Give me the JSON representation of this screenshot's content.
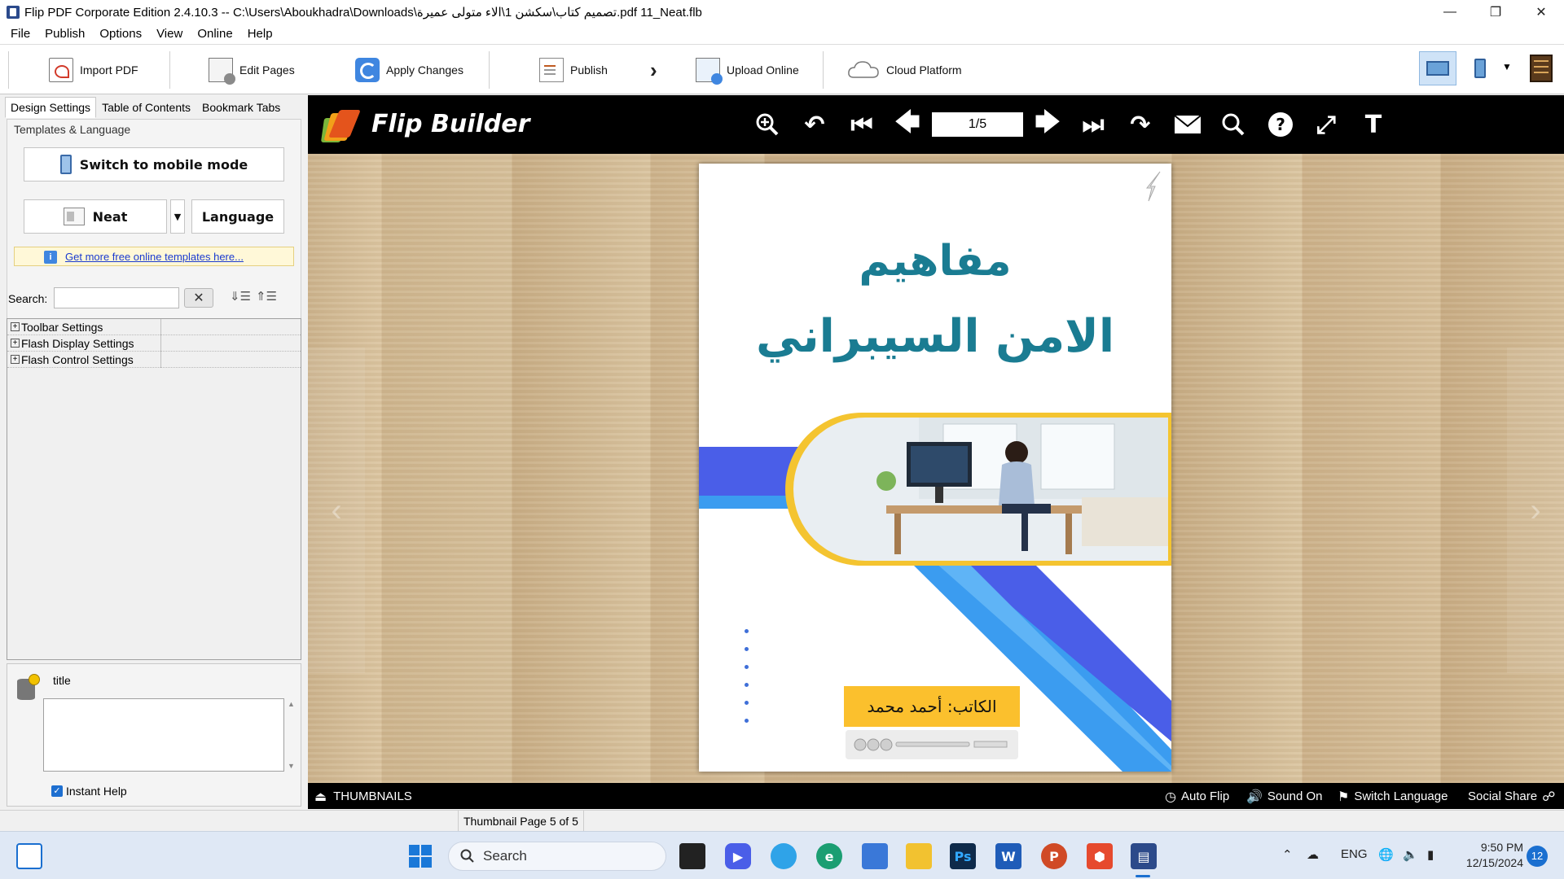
{
  "window": {
    "title": "Flip PDF Corporate Edition 2.4.10.3 -- C:\\Users\\Aboukhadra\\Downloads\\تصميم كتاب\\سكشن 1\\الاء متولى عميرة.pdf 11_Neat.flb",
    "controls": [
      "minimize",
      "restore",
      "close"
    ]
  },
  "menu": [
    "File",
    "Publish",
    "Options",
    "View",
    "Online",
    "Help"
  ],
  "toolbar": {
    "import_pdf": "Import PDF",
    "edit_pages": "Edit Pages",
    "apply_changes": "Apply Changes",
    "publish": "Publish",
    "upload_online": "Upload Online",
    "cloud_platform": "Cloud Platform"
  },
  "left_panel": {
    "tabs": [
      "Design Settings",
      "Table of Contents",
      "Bookmark Tabs"
    ],
    "active_tab": "Design Settings",
    "templates_label": "Templates & Language",
    "switch_mobile": "Switch to mobile mode",
    "template_name": "Neat",
    "language_button": "Language",
    "more_templates_link": "Get more free online templates here...",
    "search_label": "Search:",
    "search_value": "",
    "settings_groups": [
      "Toolbar Settings",
      "Flash Display Settings",
      "Flash Control Settings"
    ],
    "help_title": "title",
    "instant_help": "Instant Help",
    "instant_help_checked": true
  },
  "preview": {
    "brand": "Flip Builder",
    "page_indicator": "1/5",
    "book": {
      "title_line1": "مفاهيم",
      "title_line2": "الامن السيبراني",
      "author": "الكاتب: أحمد محمد"
    },
    "bottom_bar": {
      "thumbnails": "THUMBNAILS",
      "auto_flip": "Auto Flip",
      "sound": "Sound On",
      "switch_language": "Switch Language",
      "social_share": "Social Share"
    }
  },
  "status": {
    "text": "Thumbnail Page 5 of 5"
  },
  "taskbar": {
    "search_placeholder": "Search",
    "language": "ENG",
    "time": "9:50 PM",
    "date": "12/15/2024",
    "notifications": "12",
    "apps": [
      "file-explorer-icon",
      "zoom-icon",
      "weather-icon",
      "edge-icon",
      "store-icon",
      "folder-icon",
      "photoshop-icon",
      "word-icon",
      "powerpoint-icon",
      "office-icon",
      "flip-pdf-icon"
    ]
  },
  "colors": {
    "accent_blue": "#1a6fd0",
    "book_title": "#1a7c92",
    "author_box": "#fbc02d",
    "preview_bar": "#000000"
  }
}
